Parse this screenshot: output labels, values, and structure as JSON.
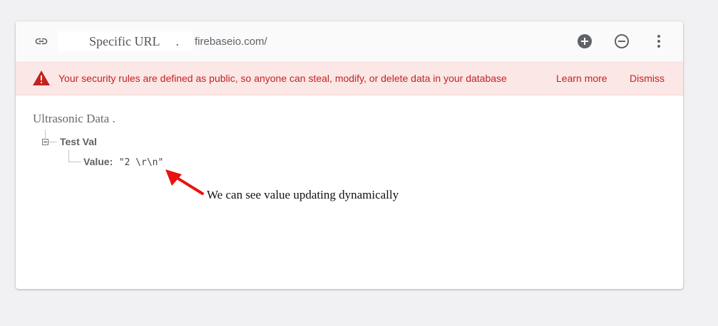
{
  "url_bar": {
    "label": "Specific URL",
    "separator": ".",
    "domain": "firebaseio.com/",
    "icons": [
      "link-icon",
      "add-circle-icon",
      "remove-circle-icon",
      "more-vert-icon"
    ]
  },
  "warning": {
    "message": "Your security rules are defined as public, so anyone can steal, modify, or delete data in your database",
    "learn_more": "Learn more",
    "dismiss": "Dismiss",
    "icon": "warning-icon"
  },
  "tree": {
    "root": "Ultrasonic Data   .",
    "node": {
      "key": "Test Val",
      "children": [
        {
          "key": "Value:",
          "value": "\"2 \\r\\n\""
        }
      ]
    }
  },
  "annotation": {
    "text": "We can see value updating dynamically",
    "icon": "red-arrow-icon"
  },
  "colors": {
    "background": "#f1f1f3",
    "card": "#ffffff",
    "warning_bg": "#fbe7e6",
    "warning_text": "#c5221f",
    "icon_gray": "#5f6368",
    "arrow": "#e8120f"
  }
}
